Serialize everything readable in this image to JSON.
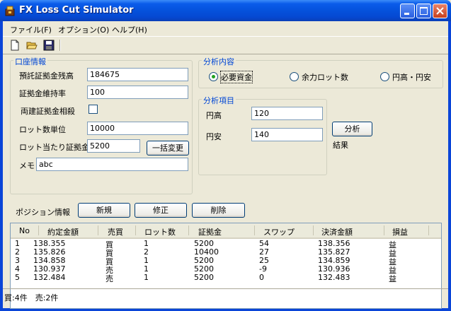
{
  "window": {
    "title": "FX Loss Cut Simulator"
  },
  "menu": [
    "ファイル(F)",
    "オプション(O)",
    "ヘルプ(H)"
  ],
  "toolbar": {
    "icons": [
      "new-file-icon",
      "open-folder-icon",
      "save-disk-icon"
    ]
  },
  "account": {
    "title": "口座情報",
    "balance_label": "預託証拠金残高",
    "balance_value": "184675",
    "maintenance_label": "証拠金維持率",
    "maintenance_value": "100",
    "offset_label": "両建証拠金相殺",
    "offset_checked": false,
    "lot_unit_label": "ロット数単位",
    "lot_unit_value": "10000",
    "margin_per_lot_label": "ロット当たり証拠金",
    "margin_per_lot_value": "5200",
    "bulk_change_label": "一括変更",
    "memo_label": "メモ",
    "memo_value": "abc"
  },
  "analysis": {
    "title": "分析内容",
    "options": [
      "必要資金",
      "余力ロット数",
      "円高・円安"
    ],
    "selected": "必要資金"
  },
  "analysis_items": {
    "title": "分析項目",
    "yen_high_label": "円高",
    "yen_high_value": "120",
    "yen_low_label": "円安",
    "yen_low_value": "140"
  },
  "analyze_button": "分析",
  "result_label": "結果",
  "positions": {
    "label": "ポジション情報",
    "new_label": "新規",
    "edit_label": "修正",
    "delete_label": "削除",
    "columns": [
      "No",
      "約定金額",
      "売買",
      "ロット数",
      "証拠金",
      "スワップ",
      "決済金額",
      "損益"
    ],
    "rows": [
      [
        "1",
        "138.355",
        "買",
        "1",
        "5200",
        "54",
        "138.356",
        "益"
      ],
      [
        "2",
        "135.826",
        "買",
        "2",
        "10400",
        "27",
        "135.827",
        "益"
      ],
      [
        "3",
        "134.858",
        "買",
        "1",
        "5200",
        "25",
        "134.859",
        "益"
      ],
      [
        "4",
        "130.937",
        "売",
        "1",
        "5200",
        "-9",
        "130.936",
        "益"
      ],
      [
        "5",
        "132.484",
        "売",
        "1",
        "5200",
        "0",
        "132.483",
        "益"
      ]
    ]
  },
  "status": "買:4件　売:2件"
}
